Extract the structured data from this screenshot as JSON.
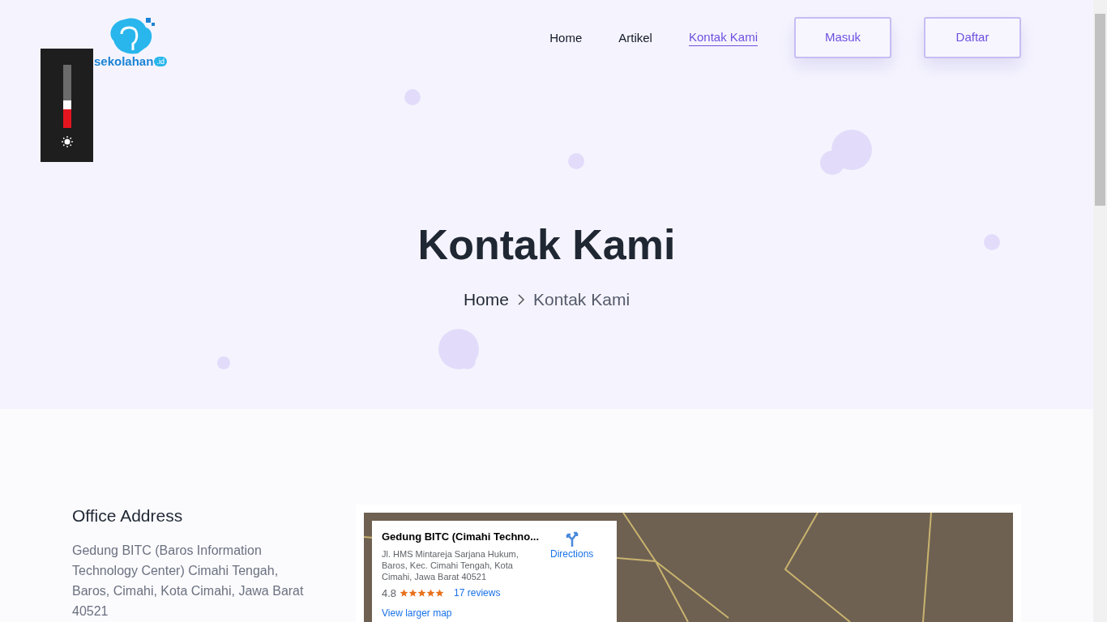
{
  "logo": {
    "name": "sekolahan",
    "suffix": ".id"
  },
  "brightness_control": {
    "level": 0.35
  },
  "nav": {
    "links": [
      {
        "label": "Home",
        "selected": false
      },
      {
        "label": "Artikel",
        "selected": false
      },
      {
        "label": "Kontak Kami",
        "selected": true
      }
    ],
    "buttons": [
      "Masuk",
      "Daftar"
    ]
  },
  "hero": {
    "title": "Kontak Kami",
    "breadcrumb": [
      "Home",
      "Kontak Kami"
    ]
  },
  "office": {
    "heading": "Office Address",
    "address": "Gedung BITC (Baros Information Technology Center) Cimahi Tengah, Baros, Cimahi, Kota Cimahi, Jawa Barat 40521"
  },
  "map_card": {
    "title": "Gedung BITC (Cimahi Techno...",
    "address": "Jl. HMS Mintareja Sarjana Hukum, Baros, Kec. Cimahi Tengah, Kota Cimahi, Jawa Barat 40521",
    "rating": "4.8",
    "stars": 5,
    "reviews": "17 reviews",
    "directions": "Directions",
    "larger_map": "View larger map"
  }
}
